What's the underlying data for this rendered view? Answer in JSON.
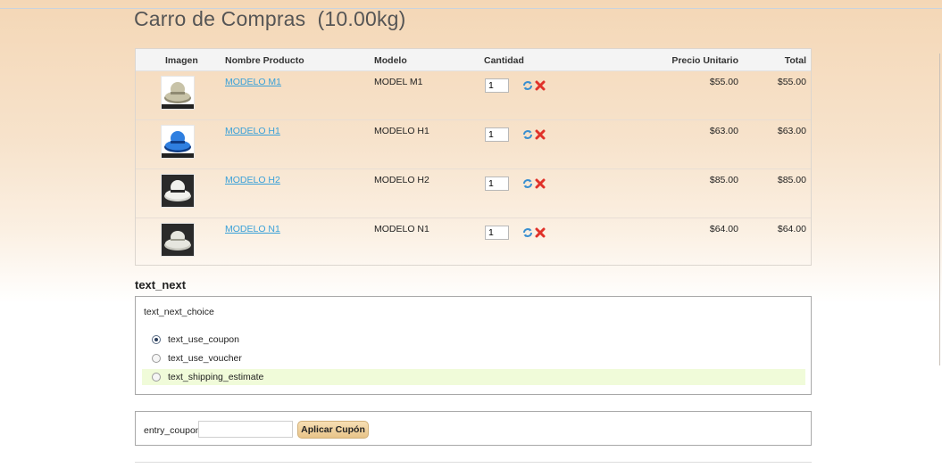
{
  "page": {
    "title": "Carro de Compras  (10.00kg)"
  },
  "cart": {
    "columns": {
      "image": "Imagen",
      "name": "Nombre Producto",
      "model": "Modelo",
      "quantity": "Cantidad",
      "unit_price": "Precio Unitario",
      "total": "Total"
    },
    "items": [
      {
        "name": "MODELO M1",
        "model": "MODEL M1",
        "quantity": "1",
        "unit_price": "$55.00",
        "total": "$55.00",
        "hat_color": "#c8c3a8",
        "band_color": "#8f8a72"
      },
      {
        "name": "MODELO H1",
        "model": "MODELO H1",
        "quantity": "1",
        "unit_price": "$63.00",
        "total": "$63.00",
        "hat_color": "#2f7fe0",
        "band_color": "#0f3d86"
      },
      {
        "name": "MODELO H2",
        "model": "MODELO H2",
        "quantity": "1",
        "unit_price": "$85.00",
        "total": "$85.00",
        "hat_color": "#f2f2ee",
        "band_color": "#2a2a2a"
      },
      {
        "name": "MODELO N1",
        "model": "MODELO N1",
        "quantity": "1",
        "unit_price": "$64.00",
        "total": "$64.00",
        "hat_color": "#e6e6df",
        "band_color": "#9a9a8e"
      }
    ],
    "row_icons": {
      "update": "refresh-icon",
      "remove": "remove-icon"
    }
  },
  "next": {
    "heading": "text_next",
    "choice_label": "text_next_choice",
    "options": [
      {
        "label": "text_use_coupon",
        "selected": true
      },
      {
        "label": "text_use_voucher",
        "selected": false
      },
      {
        "label": "text_shipping_estimate",
        "selected": false
      }
    ]
  },
  "coupon": {
    "label": "entry_coupon",
    "value": "",
    "button_label": "Aplicar Cupón"
  },
  "colors": {
    "link": "#38a0d8",
    "remove_icon": "#e0322a",
    "refresh_icon": "#3a8fd0",
    "highlight_row": "#f0fbd9"
  }
}
